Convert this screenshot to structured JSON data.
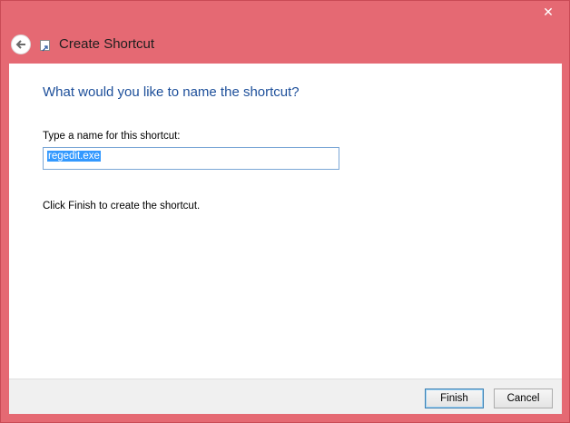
{
  "window": {
    "title": "Create Shortcut",
    "close_glyph": "✕"
  },
  "main": {
    "heading": "What would you like to name the shortcut?",
    "name_label": "Type a name for this shortcut:",
    "name_value": "regedit.exe",
    "instructions": "Click Finish to create the shortcut."
  },
  "footer": {
    "finish_label": "Finish",
    "cancel_label": "Cancel"
  },
  "icons": {
    "back": "back-arrow-icon",
    "app": "shortcut-app-icon",
    "close": "close-icon"
  },
  "colors": {
    "frame": "#e56973",
    "heading": "#1d4f9a",
    "selection": "#3399ff"
  }
}
